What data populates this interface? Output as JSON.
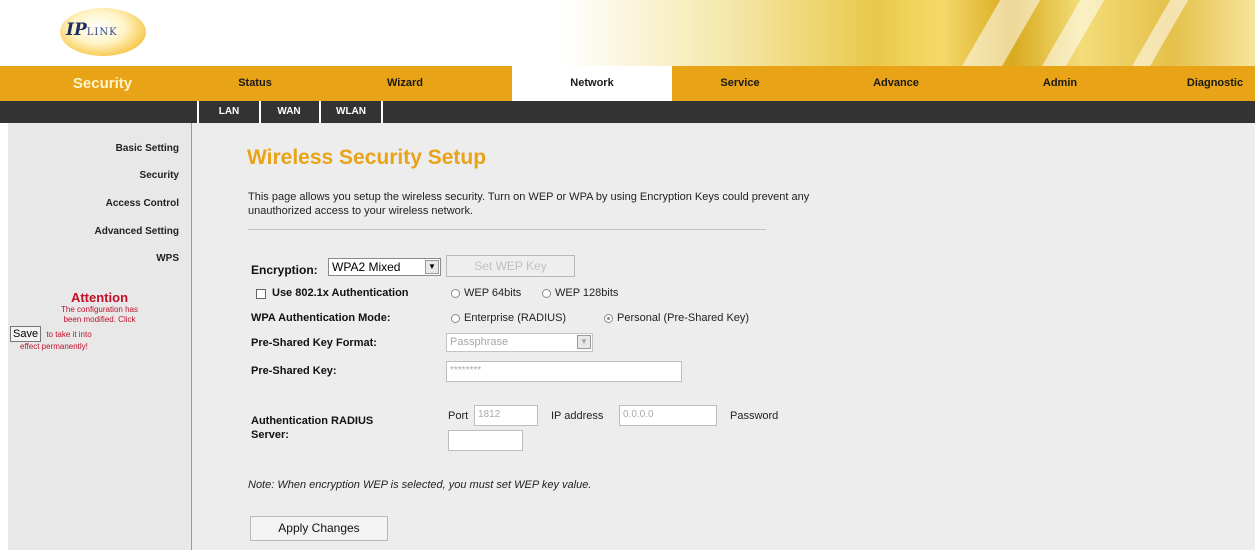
{
  "logo": {
    "text_ip": "IP",
    "text_rest": "LINK"
  },
  "nav": {
    "brand": "Security",
    "tabs": [
      "Status",
      "Wizard",
      "Network",
      "Service",
      "Advance",
      "Admin",
      "Diagnostic"
    ],
    "active": "Network"
  },
  "subnav": {
    "tabs": [
      "LAN",
      "WAN",
      "WLAN"
    ]
  },
  "sidebar": {
    "items": [
      "Basic Setting",
      "Security",
      "Access Control",
      "Advanced Setting",
      "WPS"
    ],
    "attention": {
      "title": "Attention",
      "line1": "The configuration has",
      "line2": "been modified. Click",
      "save_label": "Save",
      "line3": "to take it into",
      "line4": "effect permanently!"
    }
  },
  "main": {
    "title": "Wireless Security Setup",
    "description": "This page allows you setup the wireless security. Turn on WEP or WPA by using Encryption Keys could prevent any unauthorized access to your wireless network.",
    "encryption_label": "Encryption:",
    "encryption_value": "WPA2 Mixed",
    "set_wep_key": "Set WEP Key",
    "use_8021x": "Use 802.1x Authentication",
    "wep64": "WEP 64bits",
    "wep128": "WEP 128bits",
    "wpa_mode_label": "WPA Authentication Mode:",
    "enterprise": "Enterprise (RADIUS)",
    "personal": "Personal (Pre-Shared Key)",
    "psk_format_label": "Pre-Shared Key Format:",
    "psk_format_value": "Passphrase",
    "psk_label": "Pre-Shared Key:",
    "psk_value": "********",
    "radius_label_1": "Authentication RADIUS",
    "radius_label_2": "Server:",
    "port_label": "Port",
    "port_value": "1812",
    "ip_label": "IP address",
    "ip_value": "0.0.0.0",
    "password_label": "Password",
    "note": "Note: When encryption WEP is selected, you must set WEP key value.",
    "apply": "Apply Changes"
  }
}
